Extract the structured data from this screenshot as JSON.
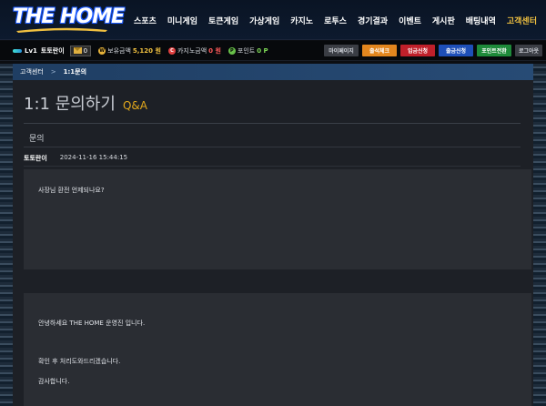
{
  "header": {
    "logo_text": "THE HOME",
    "nav": [
      {
        "label": "스포츠",
        "active": false
      },
      {
        "label": "미니게임",
        "active": false
      },
      {
        "label": "토큰게임",
        "active": false
      },
      {
        "label": "가상게임",
        "active": false
      },
      {
        "label": "카지노",
        "active": false
      },
      {
        "label": "로투스",
        "active": false
      },
      {
        "label": "경기결과",
        "active": false
      },
      {
        "label": "이벤트",
        "active": false
      },
      {
        "label": "게시판",
        "active": false
      },
      {
        "label": "배팅내역",
        "active": false
      },
      {
        "label": "고객센터",
        "active": true
      }
    ]
  },
  "userbar": {
    "level": "1",
    "level_prefix": "Lv",
    "username": "토토란이",
    "mail_count": "0",
    "balance_label": "보유금액",
    "balance_value": "5,120 원",
    "casino_label": "카지노금액",
    "casino_value": "0 원",
    "point_label": "포인트",
    "point_value": "0 P",
    "buttons": {
      "mypage": "마이페이지",
      "attendance": "출석체크",
      "deposit": "입금신청",
      "withdraw": "출금신청",
      "point_convert": "포인트전환",
      "logout": "로그아웃"
    }
  },
  "breadcrumb": {
    "home": "고객센터",
    "separator": ">",
    "current": "1:1문의"
  },
  "page": {
    "title": "1:1 문의하기",
    "subtitle": "Q&A",
    "subject": "문의",
    "author": "토토란이",
    "datetime": "2024-11-16 15:44:15",
    "question": "사장님 환전 언제되나요?",
    "answer_lines": [
      "안녕하세요 THE HOME 운영진 입니다.",
      "확인 후 처리도와드리겠습니다.",
      "감사합니다."
    ]
  },
  "colors": {
    "accent_gold": "#f0c040",
    "subtitle_gold": "#e2a81c",
    "deposit_red": "#c0202a",
    "withdraw_blue": "#1e4fb8",
    "point_green": "#1e8a3a",
    "attendance_orange": "#e2861e"
  }
}
